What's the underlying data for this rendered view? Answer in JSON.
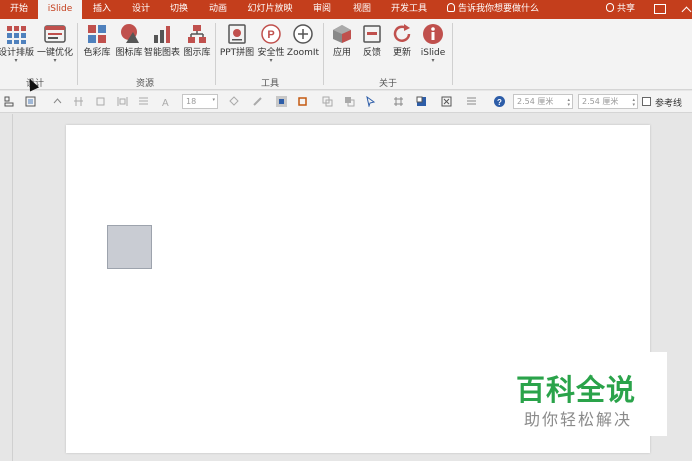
{
  "tabs": [
    {
      "label": "开始",
      "active": false
    },
    {
      "label": "iSlide",
      "active": true
    },
    {
      "label": "插入",
      "active": false
    },
    {
      "label": "设计",
      "active": false
    },
    {
      "label": "切换",
      "active": false
    },
    {
      "label": "动画",
      "active": false
    },
    {
      "label": "幻灯片放映",
      "active": false
    },
    {
      "label": "审阅",
      "active": false
    },
    {
      "label": "视图",
      "active": false
    },
    {
      "label": "开发工具",
      "active": false
    }
  ],
  "tell_me": "告诉我你想要做什么",
  "share": "共享",
  "ribbon": {
    "buttons": [
      {
        "label": "设计排版",
        "icon": "grid-layout-icon",
        "dropdown": true
      },
      {
        "label": "一键优化",
        "icon": "optimize-icon",
        "dropdown": true
      },
      {
        "label": "色彩库",
        "icon": "color-palette-icon",
        "dropdown": false
      },
      {
        "label": "图标库",
        "icon": "shapes-icon",
        "dropdown": false
      },
      {
        "label": "智能图表",
        "icon": "bar-chart-icon",
        "dropdown": false
      },
      {
        "label": "图示库",
        "icon": "diagram-icon",
        "dropdown": false
      },
      {
        "label": "PPT拼图",
        "icon": "puzzle-icon",
        "dropdown": false
      },
      {
        "label": "安全性",
        "icon": "security-icon",
        "dropdown": true
      },
      {
        "label": "ZoomIt",
        "icon": "zoom-icon",
        "dropdown": false
      },
      {
        "label": "应用",
        "icon": "cube-icon",
        "dropdown": false
      },
      {
        "label": "反馈",
        "icon": "feedback-icon",
        "dropdown": false
      },
      {
        "label": "更新",
        "icon": "refresh-icon",
        "dropdown": false
      },
      {
        "label": "iSlide",
        "icon": "info-icon",
        "dropdown": true
      }
    ],
    "groups": [
      "设计",
      "资源",
      "工具",
      "关于"
    ]
  },
  "toolbar": {
    "font_size": "18",
    "width": "2.54 厘米",
    "height": "2.54 厘米",
    "guides_label": "参考线"
  },
  "watermark": {
    "title": "百科全说",
    "subtitle": "助你轻松解决"
  },
  "colors": {
    "accent": "#c43e1c",
    "ribbon_bg": "#f3f3f3",
    "shape_fill": "#c9ccd3",
    "watermark_green": "#2aa34a"
  }
}
